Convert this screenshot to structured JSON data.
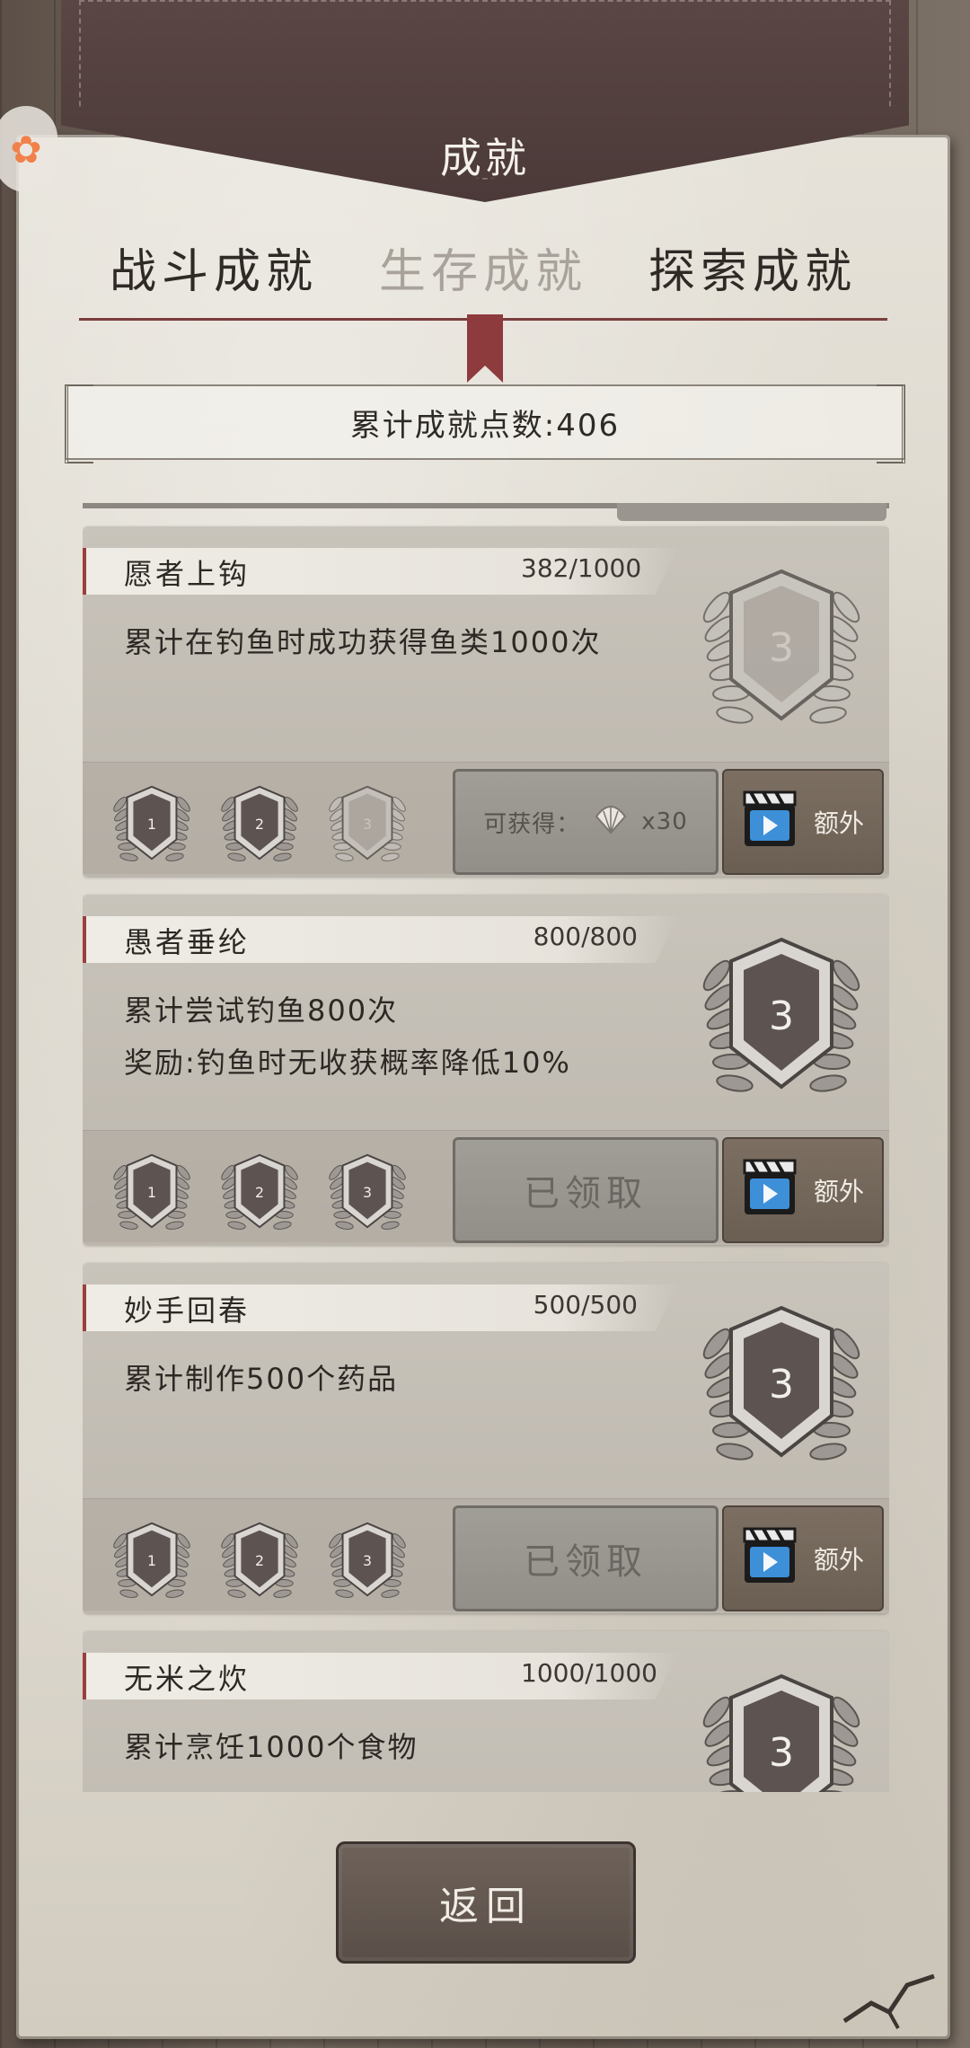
{
  "header": {
    "title": "成就"
  },
  "tabs": [
    {
      "label": "战斗成就",
      "active": false
    },
    {
      "label": "生存成就",
      "active": true
    },
    {
      "label": "探索成就",
      "active": false
    }
  ],
  "points": {
    "text": "累计成就点数:406"
  },
  "achievements": [
    {
      "name": "愿者上钩",
      "progress": "382/1000",
      "description": "累计在钓鱼时成功获得鱼类1000次",
      "level_badge": "3",
      "big_badge_complete": false,
      "badges": [
        {
          "label": "1",
          "earned": true
        },
        {
          "label": "2",
          "earned": true
        },
        {
          "label": "3",
          "earned": false
        }
      ],
      "claim": {
        "type": "reward",
        "prefix": "可获得：",
        "amount": "x30"
      },
      "extra_label": "额外"
    },
    {
      "name": "愚者垂纶",
      "progress": "800/800",
      "description": "累计尝试钓鱼800次\n奖励:钓鱼时无收获概率降低10%",
      "level_badge": "3",
      "big_badge_complete": true,
      "badges": [
        {
          "label": "1",
          "earned": true
        },
        {
          "label": "2",
          "earned": true
        },
        {
          "label": "3",
          "earned": true
        }
      ],
      "claim": {
        "type": "claimed",
        "label": "已领取"
      },
      "extra_label": "额外"
    },
    {
      "name": "妙手回春",
      "progress": "500/500",
      "description": "累计制作500个药品",
      "level_badge": "3",
      "big_badge_complete": true,
      "badges": [
        {
          "label": "1",
          "earned": true
        },
        {
          "label": "2",
          "earned": true
        },
        {
          "label": "3",
          "earned": true
        }
      ],
      "claim": {
        "type": "claimed",
        "label": "已领取"
      },
      "extra_label": "额外"
    },
    {
      "name": "无米之炊",
      "progress": "1000/1000",
      "description": "累计烹饪1000个食物",
      "level_badge": "3",
      "big_badge_complete": true,
      "badges": [],
      "claim": null,
      "extra_label": ""
    }
  ],
  "footer": {
    "back_label": "返回"
  },
  "colors": {
    "accent_red": "#8e3b3e",
    "paper": "#ddd8ce",
    "wood": "#6b5f55"
  },
  "icons": [
    "laurel-badge-icon",
    "shell-icon",
    "video-clapper-icon"
  ]
}
